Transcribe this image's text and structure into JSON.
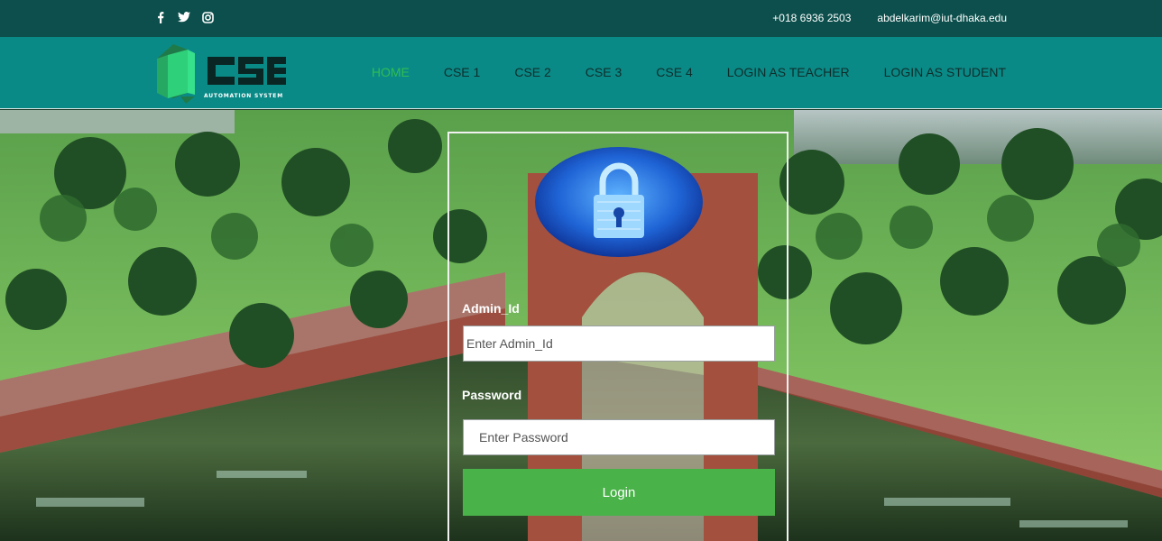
{
  "topbar": {
    "social": [
      "facebook-icon",
      "twitter-icon",
      "instagram-icon"
    ],
    "phone": "+018 6936 2503",
    "email": "abdelkarim@iut-dhaka.edu"
  },
  "brand": {
    "title": "CSE",
    "subtitle": "AUTOMATION SYSTEM"
  },
  "nav": {
    "items": [
      "HOME",
      "CSE 1",
      "CSE 2",
      "CSE 3",
      "CSE 4",
      "LOGIN AS TEACHER",
      "LOGIN AS STUDENT"
    ],
    "active": "HOME"
  },
  "login": {
    "icon": "padlock-icon",
    "admin_label": "Admin_Id",
    "admin_placeholder": "Enter Admin_Id",
    "password_label": "Password",
    "password_placeholder": "Enter Password",
    "button_label": "Login"
  },
  "colors": {
    "topbar": "#0c4f4c",
    "navbar": "#0a8a87",
    "active_nav": "#2fbd53",
    "button": "#49b249"
  }
}
